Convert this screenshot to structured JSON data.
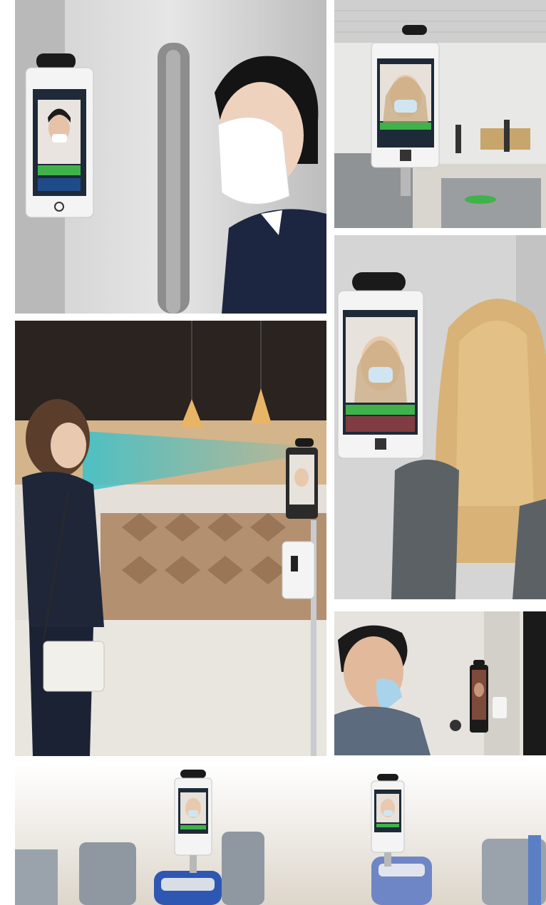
{
  "collage": {
    "panels": [
      {
        "id": "p1",
        "subject": "woman-with-mask-at-wall-terminal"
      },
      {
        "id": "p2",
        "subject": "terminal-on-turnstile-lobby"
      },
      {
        "id": "p3",
        "subject": "terminal-with-blonde-woman"
      },
      {
        "id": "p4",
        "subject": "woman-scanned-by-stand-terminal"
      },
      {
        "id": "p5",
        "subject": "man-with-mask-at-wall-terminal"
      },
      {
        "id": "p6",
        "subject": "terminals-on-turnstile-gates"
      }
    ]
  },
  "colors": {
    "device_white": "#f4f4f4",
    "device_black": "#1a1a1a",
    "screen_green": "#3fb24a",
    "scan_beam": "#3fc1c9",
    "turnstile_blue": "#2d57b3"
  }
}
